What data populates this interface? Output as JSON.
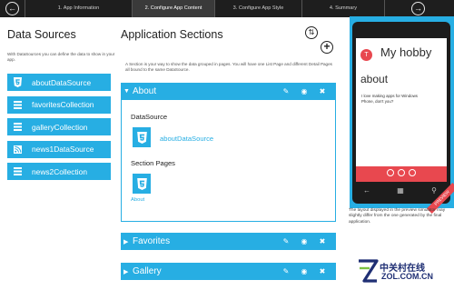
{
  "steps": {
    "items": [
      {
        "label": "1. App Information"
      },
      {
        "label": "2. Configure App Content"
      },
      {
        "label": "3. Configure App Style"
      },
      {
        "label": "4. Summary"
      }
    ],
    "active_index": 1,
    "prev_icon": "arrow-left-icon",
    "next_icon": "arrow-right-icon"
  },
  "data_sources": {
    "title": "Data Sources",
    "description": "With DataSources you can define the data to show in your app.",
    "items": [
      {
        "label": "aboutDataSource",
        "icon": "html5-icon"
      },
      {
        "label": "favoritesCollection",
        "icon": "collection-icon"
      },
      {
        "label": "galleryCollection",
        "icon": "collection-icon"
      },
      {
        "label": "news1DataSource",
        "icon": "rss-icon"
      },
      {
        "label": "news2Collection",
        "icon": "collection-icon"
      }
    ]
  },
  "sections": {
    "title": "Application Sections",
    "description": "A Section is your way to show the data grouped in pages. You will have one List Page and different Detail Pages all bound to the same DataSource.",
    "refresh_icon": "refresh-icon",
    "add_icon": "add-icon",
    "items": [
      {
        "label": "About",
        "expanded": true
      },
      {
        "label": "Favorites",
        "expanded": false
      },
      {
        "label": "Gallery",
        "expanded": false
      }
    ],
    "about": {
      "datasource_heading": "DataSource",
      "datasource_name": "aboutDataSource",
      "pages_heading": "Section Pages",
      "page_label": "About"
    },
    "header_icons": [
      "edit-icon",
      "view-icon",
      "close-icon"
    ]
  },
  "preview": {
    "app_initial": "T",
    "app_title": "My hobby",
    "page_title": "about",
    "page_text": "I love making apps for Windows Phone, don't you?",
    "ribbon": "PREVIEW",
    "note": "The layout displayed in the preview simulator may slightly differ from the one generated by the final application."
  },
  "watermark": {
    "cn": "中关村在线",
    "en": "ZOL.COM.CN"
  },
  "colors": {
    "accent": "#27aee3",
    "topbar": "#1e1e1e",
    "app_red": "#e8484f"
  }
}
